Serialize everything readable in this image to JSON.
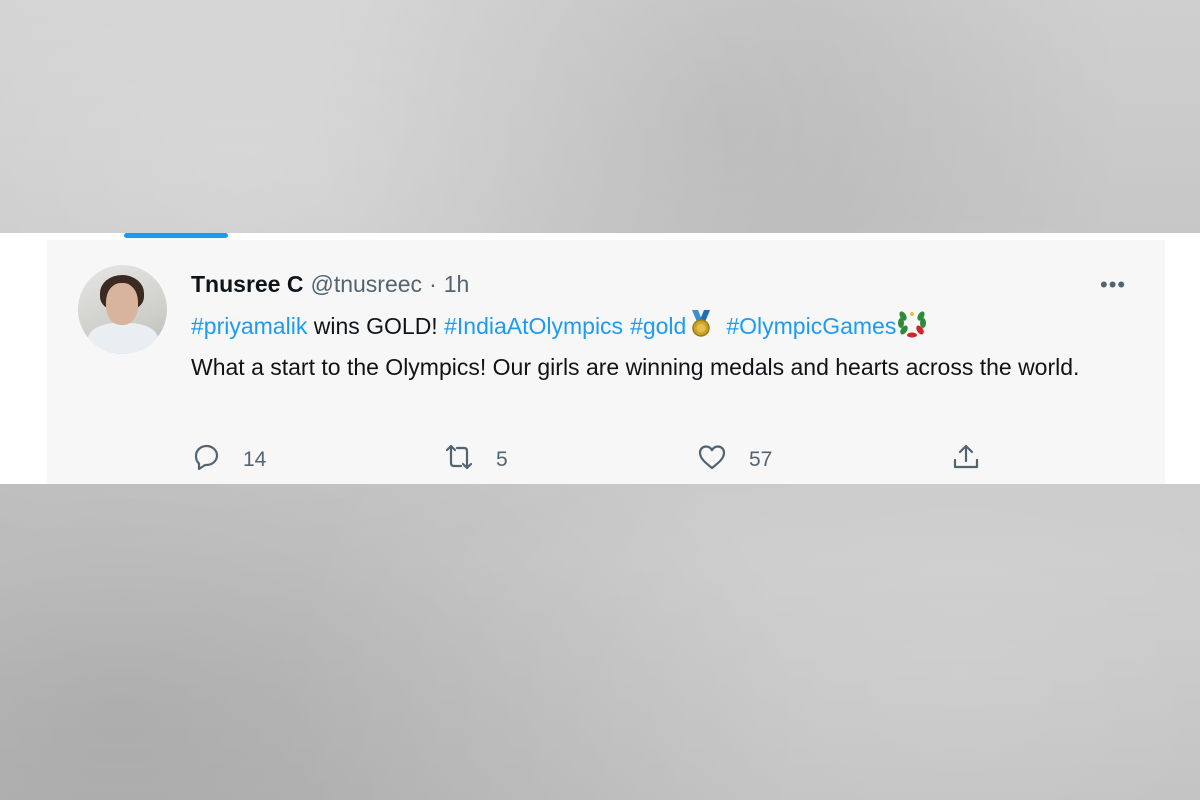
{
  "tweet": {
    "display_name": "Tnusree C",
    "handle": "@tnusreec",
    "separator": "·",
    "time": "1h",
    "line1": {
      "tag1": "#priyamalik",
      "text1": " wins GOLD! ",
      "tag2": "#IndiaAtOlympics",
      "tag3": "#gold",
      "tag4": "#OlympicGames"
    },
    "body": "What a start to the Olympics! Our girls are winning medals and hearts across the world.",
    "emoji_1": "medal-icon",
    "emoji_2": "laurel-wreath-icon"
  },
  "actions": {
    "reply_count": "14",
    "retweet_count": "5",
    "like_count": "57"
  },
  "menu": {
    "more_label": "•••"
  },
  "colors": {
    "link": "#1d9bf0",
    "text": "#0f1419",
    "muted": "#536471",
    "tab_indicator": "#1d9bf0"
  }
}
